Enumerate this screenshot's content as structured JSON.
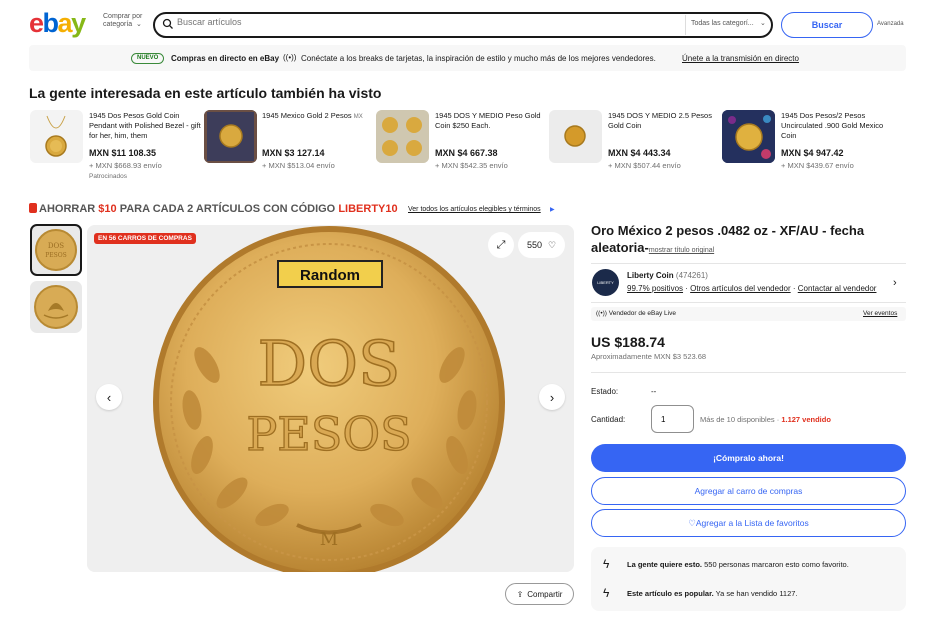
{
  "header": {
    "logo_letters": [
      {
        "ch": "e",
        "color": "#e53238"
      },
      {
        "ch": "b",
        "color": "#0064d2"
      },
      {
        "ch": "a",
        "color": "#f5af02"
      },
      {
        "ch": "y",
        "color": "#86b817"
      }
    ],
    "category_label": "Comprar por categoría",
    "search_placeholder": "Buscar artículos",
    "category_select": "Todas las categorí...",
    "search_button": "Buscar",
    "advanced": "Avanzada"
  },
  "banner": {
    "badge": "NUEVO",
    "bold": "Compras en directo en eBay",
    "text": "Conéctate a los breaks de tarjetas, la inspiración de estilo y mucho más de los mejores vendedores.",
    "link": "Únete a la transmisión en directo"
  },
  "related": {
    "title": "La gente interesada en este artículo también ha visto",
    "sponsored": "Patrocinados",
    "items": [
      {
        "name": "1945 Dos Pesos Gold Coin Pendant with Polished Bezel - gift for her, him, them",
        "price": "MXN $11 108.35",
        "shipping": "+ MXN $668.93 envío"
      },
      {
        "name": "1945 Mexico Gold 2 Pesos",
        "suffix": "MX",
        "price": "MXN $3 127.14",
        "shipping": "+ MXN $513.04 envío"
      },
      {
        "name": "1945 DOS Y MEDIO Peso Gold Coin $250 Each.",
        "price": "MXN $4 667.38",
        "shipping": "+ MXN $542.35 envío"
      },
      {
        "name": "1945 DOS Y MEDIO 2.5 Pesos Gold Coin",
        "price": "MXN $4 443.34",
        "shipping": "+ MXN $507.44 envío"
      },
      {
        "name": "1945 Dos Pesos/2 Pesos Uncirculated .900 Gold Mexico Coin",
        "price": "MXN $4 947.42",
        "shipping": "+ MXN $439.67 envío"
      }
    ]
  },
  "promo": {
    "prefix": "AHORRAR",
    "amount": "$10",
    "middle": "PARA CADA 2 ARTÍCULOS CON CÓDIGO",
    "code": "LIBERTY10",
    "link": "Ver todos los artículos elegibles y términos"
  },
  "gallery": {
    "badge": "EN 56 CARROS DE COMPRAS",
    "watch_count": "550",
    "coin_label": "Random",
    "coin_top": "DOS",
    "coin_bottom": "PESOS",
    "coin_mint": "M",
    "share": "Compartir"
  },
  "item": {
    "title": "Oro México 2 pesos .0482 oz - XF/AU - fecha aleatoria-",
    "show_original": "mostrar título original",
    "seller": {
      "logo_text": "LIBERTY",
      "name": "Liberty Coin",
      "count": "(474261)",
      "positive": "99.7% positivos",
      "other_items": "Otros artículos del vendedor",
      "contact": "Contactar al vendedor"
    },
    "live_seller": "Vendedor de eBay Live",
    "live_events": "Ver eventos",
    "price": "US $188.74",
    "approx_label": "Aproximadamente",
    "approx_value": "MXN $3 523.68",
    "condition_label": "Estado:",
    "condition_value": "--",
    "quantity_label": "Cantidad:",
    "quantity_value": "1",
    "available": "Más de 10 disponibles",
    "sold": "1.127 vendido",
    "buy_now": "¡Cómpralo ahora!",
    "add_cart": "Agregar al carro de compras",
    "add_watch": "Agregar a la Lista de favoritos",
    "info": [
      {
        "bold": "La gente quiere esto.",
        "text": "550 personas marcaron esto como favorito."
      },
      {
        "bold": "Este artículo es popular.",
        "text": "Ya se han vendido 1127."
      }
    ]
  },
  "colors": {
    "accent": "#3665f3",
    "gold": "#d4a446",
    "sold_red": "#e0301e"
  }
}
